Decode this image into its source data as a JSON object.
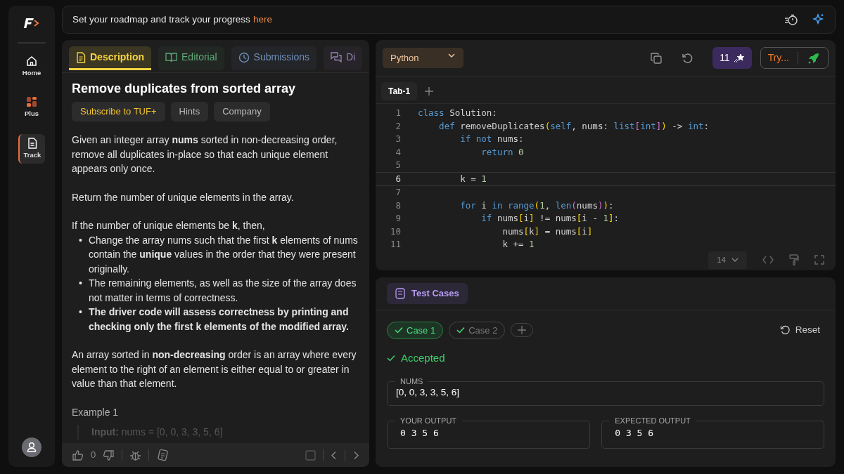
{
  "sidebar": {
    "items": [
      {
        "label": "Home",
        "selected": false
      },
      {
        "label": "Plus",
        "selected": false
      },
      {
        "label": "Track",
        "selected": true
      }
    ]
  },
  "banner": {
    "text": "Set your roadmap and track your progress",
    "link": "here"
  },
  "problem_tabs": [
    {
      "label": "Description",
      "color": "#f5d442",
      "selected": true
    },
    {
      "label": "Editorial",
      "color": "#5fa878",
      "selected": false
    },
    {
      "label": "Submissions",
      "color": "#6f8fb8",
      "selected": false
    },
    {
      "label": "Di",
      "color": "#9a82b8",
      "selected": false
    }
  ],
  "problem": {
    "title": "Remove duplicates from sorted array",
    "chips": [
      {
        "label": "Subscribe to TUF+",
        "kind": "premium"
      },
      {
        "label": "Hints",
        "kind": "plain"
      },
      {
        "label": "Company",
        "kind": "plain"
      }
    ],
    "blocks": [
      {
        "kind": "paragraph",
        "text": "Given an integer array **nums** sorted in non-decreasing order, remove all duplicates in-place so that each unique element appears only once."
      },
      {
        "kind": "paragraph",
        "text": "Return the number of unique elements in the array."
      },
      {
        "kind": "paragraph",
        "text": "If the number of unique elements be **k**, then,",
        "bullets": [
          {
            "marker": "•",
            "text": "Change the array nums such that the first **k** elements of nums contain the **unique** values in the order that they were present originally.",
            "bold": false
          },
          {
            "marker": "•",
            "text": "The remaining elements, as well as the size of the array does not matter in terms of correctness.",
            "bold": false
          },
          {
            "marker": "•",
            "text": "The driver code will assess correctness by printing and checking only the first k elements of the modified array.",
            "bold": true
          }
        ]
      },
      {
        "kind": "paragraph",
        "text": "An array sorted in **non-decreasing** order is an array where every element to the right of an element is either equal to or greater in value than that element."
      },
      {
        "kind": "heading",
        "text": "Example 1"
      },
      {
        "kind": "example",
        "text": "**Input:** nums = [0, 0, 3, 3, 5, 6]"
      }
    ]
  },
  "problem_footer": {
    "likes": "0"
  },
  "editor": {
    "language": "Python",
    "credits": "11",
    "try_button": "Try...",
    "tabs": [
      {
        "label": "Tab-1",
        "selected": true
      }
    ],
    "lines": [
      {
        "number": "1",
        "current": false,
        "tokens": [
          {
            "kind": "kw",
            "text": "class"
          },
          {
            "kind": "plain",
            "text": " Solution:"
          }
        ]
      },
      {
        "number": "2",
        "current": false,
        "tokens": [
          {
            "kind": "kw",
            "text": "    def"
          },
          {
            "kind": "plain",
            "text": " removeDuplicates"
          },
          {
            "kind": "br1",
            "text": "("
          },
          {
            "kind": "kw",
            "text": "self"
          },
          {
            "kind": "plain",
            "text": ", nums: "
          },
          {
            "kind": "kw",
            "text": "list"
          },
          {
            "kind": "br2",
            "text": "["
          },
          {
            "kind": "kw",
            "text": "int"
          },
          {
            "kind": "br2",
            "text": "]"
          },
          {
            "kind": "br1",
            "text": ")"
          },
          {
            "kind": "plain",
            "text": " -> "
          },
          {
            "kind": "kw",
            "text": "int"
          },
          {
            "kind": "plain",
            "text": ":"
          }
        ]
      },
      {
        "number": "3",
        "current": false,
        "tokens": [
          {
            "kind": "kw",
            "text": "        if not"
          },
          {
            "kind": "plain",
            "text": " nums:"
          }
        ]
      },
      {
        "number": "4",
        "current": false,
        "tokens": [
          {
            "kind": "kw",
            "text": "            return "
          },
          {
            "kind": "num",
            "text": "0"
          }
        ]
      },
      {
        "number": "5",
        "current": false
      },
      {
        "number": "6",
        "current": true,
        "tokens": [
          {
            "kind": "plain",
            "text": "        k = "
          },
          {
            "kind": "num",
            "text": "1"
          }
        ]
      },
      {
        "number": "7",
        "current": false
      },
      {
        "number": "8",
        "current": false,
        "tokens": [
          {
            "kind": "kw",
            "text": "        for"
          },
          {
            "kind": "plain",
            "text": " i "
          },
          {
            "kind": "kw",
            "text": "in range"
          },
          {
            "kind": "br1",
            "text": "("
          },
          {
            "kind": "num",
            "text": "1"
          },
          {
            "kind": "plain",
            "text": ", "
          },
          {
            "kind": "kw",
            "text": "len"
          },
          {
            "kind": "br2",
            "text": "("
          },
          {
            "kind": "plain",
            "text": "nums"
          },
          {
            "kind": "br2",
            "text": ")"
          },
          {
            "kind": "br1",
            "text": ")"
          },
          {
            "kind": "plain",
            "text": ":"
          }
        ]
      },
      {
        "number": "9",
        "current": false,
        "tokens": [
          {
            "kind": "kw",
            "text": "            if"
          },
          {
            "kind": "plain",
            "text": " nums"
          },
          {
            "kind": "br1",
            "text": "["
          },
          {
            "kind": "plain",
            "text": "i"
          },
          {
            "kind": "br1",
            "text": "]"
          },
          {
            "kind": "plain",
            "text": " != nums"
          },
          {
            "kind": "br1",
            "text": "["
          },
          {
            "kind": "plain",
            "text": "i - "
          },
          {
            "kind": "num",
            "text": "1"
          },
          {
            "kind": "br1",
            "text": "]"
          },
          {
            "kind": "plain",
            "text": ":"
          }
        ]
      },
      {
        "number": "10",
        "current": false,
        "tokens": [
          {
            "kind": "plain",
            "text": "                nums"
          },
          {
            "kind": "br1",
            "text": "["
          },
          {
            "kind": "plain",
            "text": "k"
          },
          {
            "kind": "br1",
            "text": "]"
          },
          {
            "kind": "plain",
            "text": " = nums"
          },
          {
            "kind": "br1",
            "text": "["
          },
          {
            "kind": "plain",
            "text": "i"
          },
          {
            "kind": "br1",
            "text": "]"
          }
        ]
      },
      {
        "number": "11",
        "current": false,
        "tokens": [
          {
            "kind": "plain",
            "text": "                k += "
          },
          {
            "kind": "num",
            "text": "1"
          }
        ]
      }
    ],
    "font_size": "14"
  },
  "test_panel": {
    "tab": "Test Cases",
    "cases": [
      {
        "label": "Case 1",
        "passed": true,
        "selected": true
      },
      {
        "label": "Case 2",
        "passed": true,
        "selected": false
      }
    ],
    "reset": "Reset",
    "verdict": "Accepted",
    "input": {
      "label": "NUMS",
      "value": "[0, 0, 3, 3, 5, 6]"
    },
    "outputs": [
      {
        "label": "YOUR OUTPUT",
        "value": "0 3 5 6"
      },
      {
        "label": "EXPECTED OUTPUT",
        "value": "0 3 5 6"
      }
    ]
  }
}
